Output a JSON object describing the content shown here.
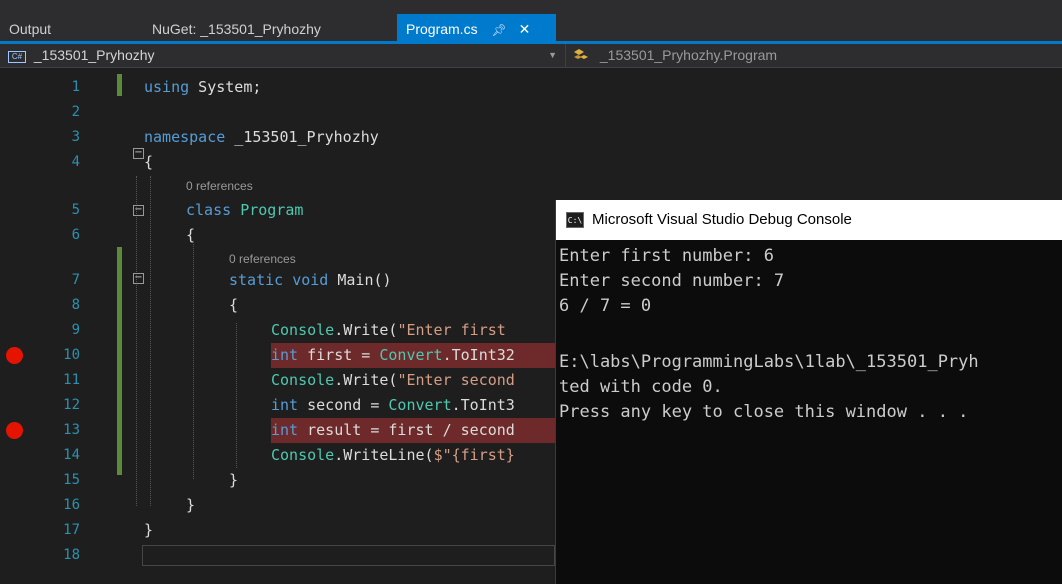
{
  "tabs": [
    {
      "label": "Output",
      "active": false
    },
    {
      "label": "NuGet: _153501_Pryhozhy",
      "active": false
    },
    {
      "label": "Program.cs",
      "active": true
    }
  ],
  "tab_icons": {
    "pin": "pin-icon",
    "close": "close-icon"
  },
  "navbar": {
    "project": "_153501_Pryhozhy",
    "project_badge": "C#",
    "member": "_153501_Pryhozhy.Program",
    "member_icon": "class-icon"
  },
  "code": {
    "line_numbers": [
      "1",
      "2",
      "3",
      "4",
      "5",
      "6",
      "7",
      "8",
      "9",
      "10",
      "11",
      "12",
      "13",
      "14",
      "15",
      "16",
      "17",
      "18"
    ],
    "refs_5": "0 references",
    "refs_7": "0 references",
    "l1_kw": "using",
    "l1_rest": " System;",
    "l3_kw": "namespace",
    "l3_rest": " _153501_Pryhozhy",
    "l4": "{",
    "l5_kw": "class",
    "l5_ty": "Program",
    "l6": "{",
    "l7_kw": "static void",
    "l7_rest": " Main()",
    "l8": "{",
    "l9_ty": "Console",
    "l9_mid": ".Write(",
    "l9_str": "\"Enter first",
    "l10_kw": "int",
    "l10_mid": " first = ",
    "l10_ty": "Convert",
    "l10_rest": ".ToInt32",
    "l11_ty": "Console",
    "l11_mid": ".Write(",
    "l11_str": "\"Enter second",
    "l12_kw": "int",
    "l12_mid": " second = ",
    "l12_ty": "Convert",
    "l12_rest": ".ToInt3",
    "l13_kw": "int",
    "l13_rest": " result = first / second",
    "l14_ty": "Console",
    "l14_mid": ".WriteLine(",
    "l14_str": "$\"{first}",
    "l15": "}",
    "l16": "}",
    "l17": "}"
  },
  "breakpoints": [
    10,
    13
  ],
  "colors": {
    "accent": "#007acc",
    "breakpoint": "#e51400",
    "breakpoint_line": "#6e2a2a",
    "change_bar": "#5a8a3a"
  },
  "console": {
    "icon": "console-icon",
    "icon_text": "C:\\",
    "title": "Microsoft Visual Studio Debug Console",
    "lines": [
      "Enter first number: 6",
      "Enter second number: 7",
      "6 / 7 = 0",
      "",
      "E:\\labs\\ProgrammingLabs\\1lab\\_153501_Pryh",
      "ted with code 0.",
      "Press any key to close this window . . ."
    ]
  }
}
